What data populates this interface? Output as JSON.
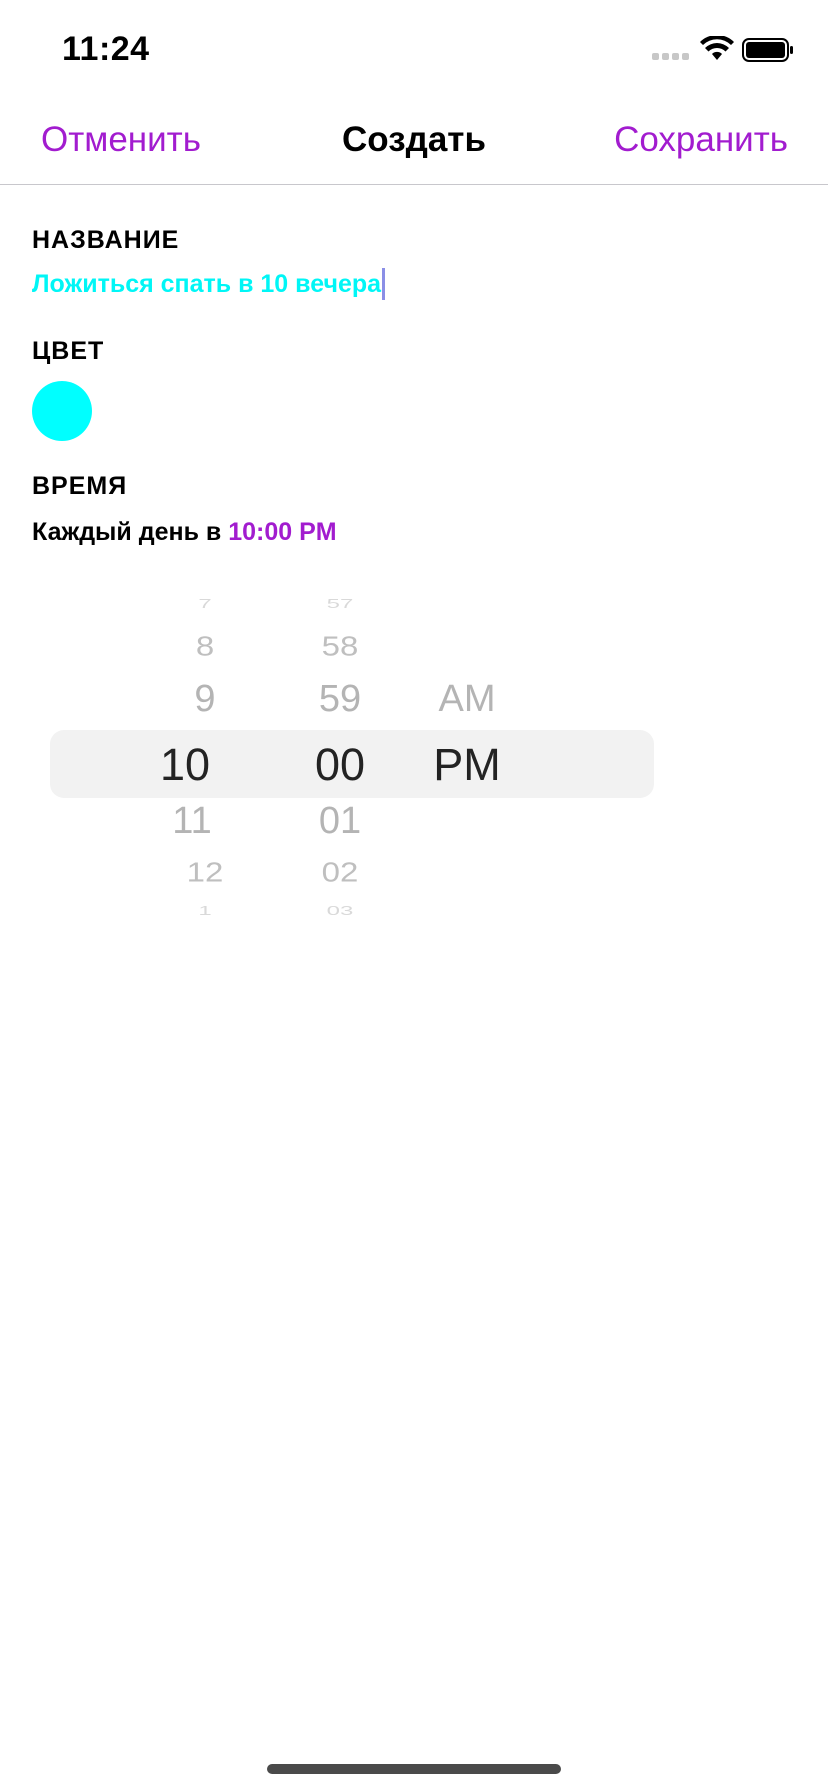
{
  "status_bar": {
    "time": "11:24",
    "icons": [
      "signal-dots-icon",
      "wifi-icon",
      "battery-icon"
    ]
  },
  "nav": {
    "cancel_label": "Отменить",
    "title": "Создать",
    "save_label": "Сохранить",
    "accent_color": "#a21ccf"
  },
  "form": {
    "name_label": "НАЗВАНИЕ",
    "name_value": "Ложиться спать в 10 вечера",
    "name_color": "#00f6f6",
    "color_label": "ЦВЕТ",
    "color_value": "#00ffff",
    "time_label": "ВРЕМЯ",
    "time_prefix": "Каждый день в",
    "time_value": "10:00 PM"
  },
  "picker": {
    "hours": [
      "7",
      "8",
      "9",
      "10",
      "11",
      "12",
      "1"
    ],
    "minutes": [
      "57",
      "58",
      "59",
      "00",
      "01",
      "02",
      "03"
    ],
    "periods": [
      "AM",
      "PM"
    ],
    "selected_hour": "10",
    "selected_minute": "00",
    "selected_period": "PM"
  }
}
